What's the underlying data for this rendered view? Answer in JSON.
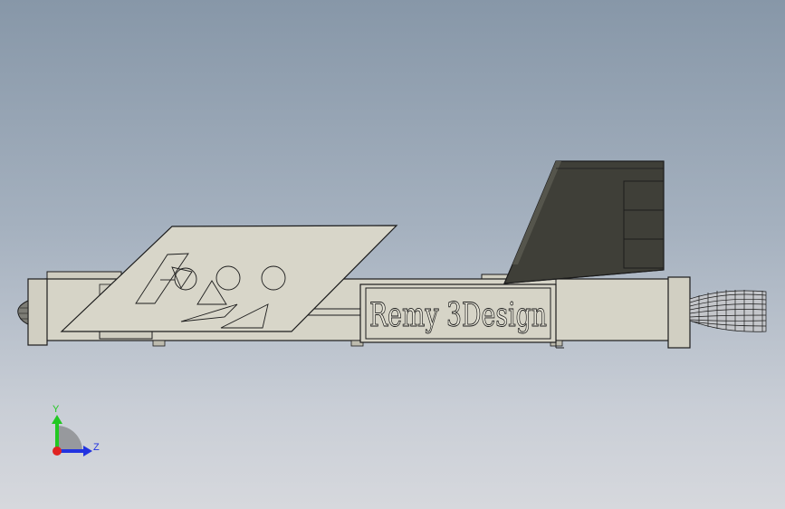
{
  "model": {
    "engraving_text": "Remy 3Design",
    "body_color": "#d6d4c7",
    "fin_color": "#3f3f38",
    "line_color": "#1c1c1c"
  },
  "triad": {
    "y_label": "Y",
    "z_label": "Z",
    "y_color": "#22c822",
    "z_color": "#2233e0",
    "x_color": "#e02222"
  }
}
